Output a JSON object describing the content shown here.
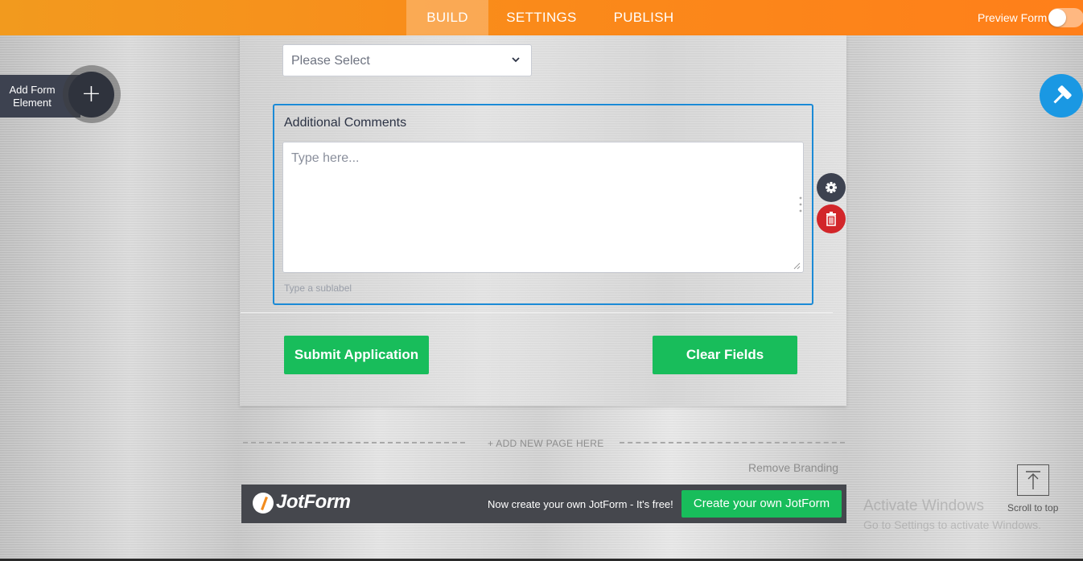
{
  "topbar": {
    "tabs": [
      {
        "label": "BUILD",
        "active": true
      },
      {
        "label": "SETTINGS",
        "active": false
      },
      {
        "label": "PUBLISH",
        "active": false
      }
    ],
    "preview_label": "Preview Form",
    "preview_on": false,
    "accent": "#fa8a1a"
  },
  "add_element": {
    "label": "Add Form Element",
    "icon": "plus-icon"
  },
  "form": {
    "dropdown_value": "Please Select",
    "comments_label": "Additional Comments",
    "comments_placeholder": "Type here...",
    "sublabel_placeholder": "Type a sublabel",
    "submit_label": "Submit Application",
    "clear_label": "Clear Fields",
    "button_color": "#18bd5b",
    "selected_border": "#1b8ad6"
  },
  "field_actions": {
    "settings_icon": "gear-icon",
    "delete_icon": "trash-icon"
  },
  "add_page_label": "+ ADD NEW PAGE HERE",
  "remove_branding": "Remove Branding",
  "jotform_bar": {
    "logo_text": "JotForm",
    "tagline": "Now create your own JotForm - It's free!",
    "cta_label": "Create your own JotForm"
  },
  "designer_icon": "paint-roller-icon",
  "scroll_top": {
    "label": "Scroll to top",
    "icon": "arrow-up-icon"
  },
  "watermark": {
    "line1": "Activate Windows",
    "line2": "Go to Settings to activate Windows."
  }
}
